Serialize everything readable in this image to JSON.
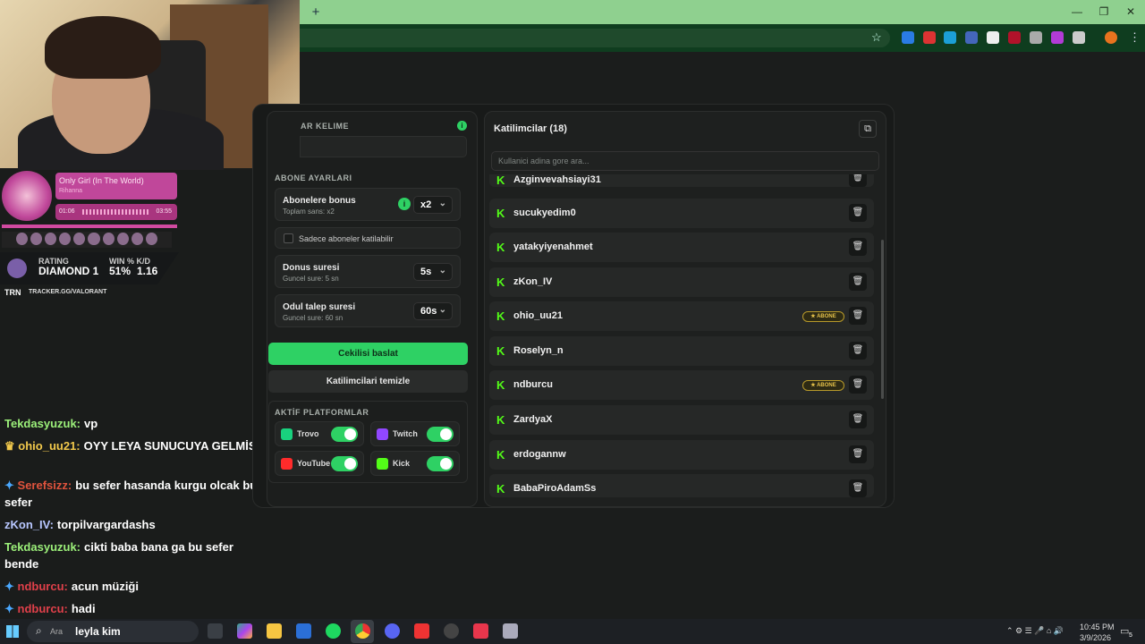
{
  "overlay": {
    "song_title": "Only Girl (In The World)",
    "song_artist": "Rihanna",
    "time_elapsed": "01:06",
    "time_total": "03:55",
    "rating_label": "RATING",
    "rating_value": "DIAMOND 1",
    "winkd_label": "WIN % K/D",
    "win_pct": "51%",
    "kd": "1.16",
    "trn_label": "TRN",
    "tracker_url": "TRACKER.GG/VALORANT"
  },
  "chat": [
    {
      "user": "Tekdasyuzuk:",
      "color": "#9cf07a",
      "text": "vp"
    },
    {
      "user": "ohio_uu21:",
      "color": "#f2c94c",
      "text": "OYY LEYA SUNUCUYA GELMİS"
    },
    {
      "user": "Serefsizz:",
      "color": "#e0533d",
      "text": "bu sefer hasanda kurgu olcak bu sefer"
    },
    {
      "user": "zKon_IV:",
      "color": "#b8c7ff",
      "text": "torpilvargardashs"
    },
    {
      "user": "Tekdasyuzuk:",
      "color": "#9cf07a",
      "text": "cikti baba bana ga bu sefer bende"
    },
    {
      "user": "ndburcu:",
      "color": "#e0404a",
      "text": "acun müziği"
    },
    {
      "user": "ndburcu:",
      "color": "#e0404a",
      "text": "hadi"
    }
  ],
  "left_panel": {
    "keyword_title": "AR KELIME",
    "sub_section": "ABONE AYARLARI",
    "sub_bonus_title": "Abonelere bonus",
    "sub_bonus_sub": "Toplam sans: x2",
    "sub_bonus_value": "x2",
    "subs_only": "Sadece aboneler katilabilir",
    "draw_time_title": "Donus suresi",
    "draw_time_sub": "Guncel sure: 5 sn",
    "draw_time_value": "5s",
    "claim_time_title": "Odul talep suresi",
    "claim_time_sub": "Guncel sure: 60 sn",
    "claim_time_value": "60s",
    "start_button": "Cekilisi baslat",
    "clear_button": "Katilimcilari temizle",
    "platforms_title": "AKTİF PLATFORMLAR",
    "platforms": [
      {
        "label": "Trovo",
        "color": "#19d17e",
        "enabled": true
      },
      {
        "label": "Twitch",
        "color": "#9147ff",
        "enabled": true
      },
      {
        "label": "YouTube",
        "color": "#ff2b2b",
        "enabled": true
      },
      {
        "label": "Kick",
        "color": "#53fc18",
        "enabled": true
      }
    ]
  },
  "participants": {
    "title": "Katilimcilar (18)",
    "search_placeholder": "Kullanici adina gore ara...",
    "badge_label": "ABONE",
    "rows": [
      {
        "name": "Azginvevahsiayi31",
        "sub": false
      },
      {
        "name": "sucukyedim0",
        "sub": false
      },
      {
        "name": "yatakyiyenahmet",
        "sub": false
      },
      {
        "name": "zKon_IV",
        "sub": false
      },
      {
        "name": "ohio_uu21",
        "sub": true
      },
      {
        "name": "Roselyn_n",
        "sub": false
      },
      {
        "name": "ndburcu",
        "sub": true
      },
      {
        "name": "ZardyaX",
        "sub": false
      },
      {
        "name": "erdogannw",
        "sub": false
      },
      {
        "name": "BabaPiroAdamSs",
        "sub": false
      }
    ]
  },
  "taskbar": {
    "search_label": "Ara",
    "search_text": "leyla kim",
    "time": "10:45 PM",
    "date": "3/9/2026",
    "notif_count": "5"
  }
}
